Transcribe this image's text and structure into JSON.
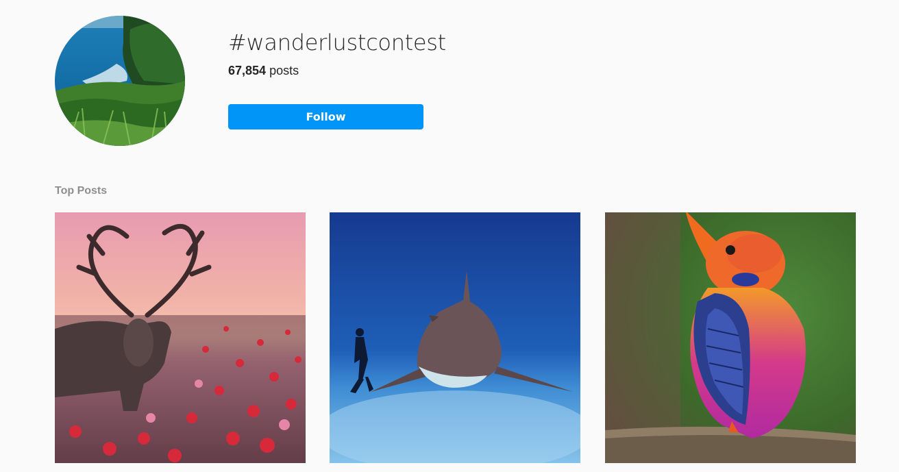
{
  "header": {
    "hashtag": "#wanderlustcontest",
    "post_count": "67,854",
    "post_count_suffix": "posts",
    "follow_label": "Follow"
  },
  "top_posts": {
    "label": "Top Posts",
    "items": [
      {
        "subject": "deer with heart-shaped antlers in poppy field"
      },
      {
        "subject": "shark and freediver underwater"
      },
      {
        "subject": "colorful kingfisher on branch"
      }
    ]
  },
  "colors": {
    "background": "#fafafa",
    "follow_button": "#0095f6",
    "section_label": "#8e8e8e",
    "text": "#262626"
  }
}
